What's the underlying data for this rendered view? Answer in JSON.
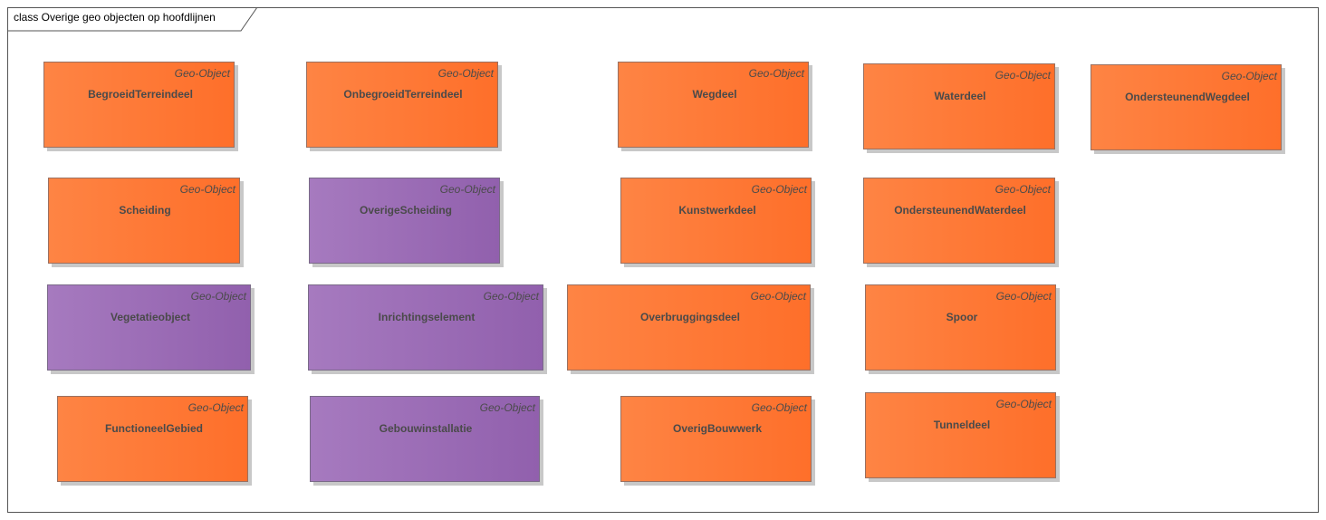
{
  "diagram": {
    "title": "class Overige geo objecten op hoofdlijnen",
    "colors": {
      "orange": "#fe7a36",
      "purple": "#9b6bb5"
    },
    "classes": [
      {
        "name": "BegroeidTerreindeel",
        "stereotype": "Geo-Object",
        "color": "orange"
      },
      {
        "name": "OnbegroeidTerreindeel",
        "stereotype": "Geo-Object",
        "color": "orange"
      },
      {
        "name": "Wegdeel",
        "stereotype": "Geo-Object",
        "color": "orange"
      },
      {
        "name": "Waterdeel",
        "stereotype": "Geo-Object",
        "color": "orange"
      },
      {
        "name": "OndersteunendWegdeel",
        "stereotype": "Geo-Object",
        "color": "orange"
      },
      {
        "name": "Scheiding",
        "stereotype": "Geo-Object",
        "color": "orange"
      },
      {
        "name": "OverigeScheiding",
        "stereotype": "Geo-Object",
        "color": "purple"
      },
      {
        "name": "Kunstwerkdeel",
        "stereotype": "Geo-Object",
        "color": "orange"
      },
      {
        "name": "OndersteunendWaterdeel",
        "stereotype": "Geo-Object",
        "color": "orange"
      },
      {
        "name": "Vegetatieobject",
        "stereotype": "Geo-Object",
        "color": "purple"
      },
      {
        "name": "Inrichtingselement",
        "stereotype": "Geo-Object",
        "color": "purple"
      },
      {
        "name": "Overbruggingsdeel",
        "stereotype": "Geo-Object",
        "color": "orange"
      },
      {
        "name": "Spoor",
        "stereotype": "Geo-Object",
        "color": "orange"
      },
      {
        "name": "FunctioneelGebied",
        "stereotype": "Geo-Object",
        "color": "orange"
      },
      {
        "name": "Gebouwinstallatie",
        "stereotype": "Geo-Object",
        "color": "purple"
      },
      {
        "name": "OverigBouwwerk",
        "stereotype": "Geo-Object",
        "color": "orange"
      },
      {
        "name": "Tunneldeel",
        "stereotype": "Geo-Object",
        "color": "orange"
      }
    ]
  }
}
